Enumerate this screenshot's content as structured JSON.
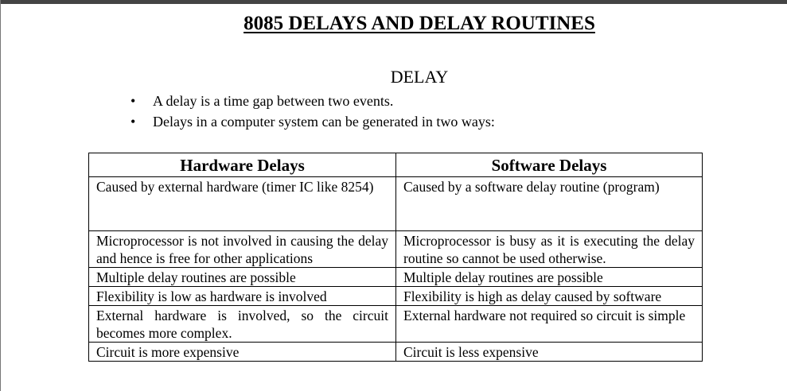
{
  "document": {
    "title": "8085 DELAYS AND DELAY ROUTINES",
    "subtitle": "DELAY",
    "bullets": [
      "A delay is a time gap between two events.",
      "Delays in a computer system can be generated in two ways:"
    ],
    "table": {
      "headers": [
        "Hardware Delays",
        "Software Delays"
      ],
      "rows": [
        [
          "Caused by external hardware (timer IC like 8254)",
          "Caused by a software delay routine (program)"
        ],
        [
          "Microprocessor is not involved in causing the delay and hence is free for other applications",
          "Microprocessor is busy as it is executing the delay routine so cannot be used otherwise."
        ],
        [
          "Multiple delay routines are possible",
          "Multiple delay routines are possible"
        ],
        [
          "Flexibility is low as hardware is involved",
          "Flexibility is high as delay caused by software"
        ],
        [
          "External hardware is involved, so the circuit becomes more complex.",
          "External hardware not required so circuit is simple"
        ],
        [
          "Circuit is more expensive",
          "Circuit is less expensive"
        ]
      ]
    }
  }
}
